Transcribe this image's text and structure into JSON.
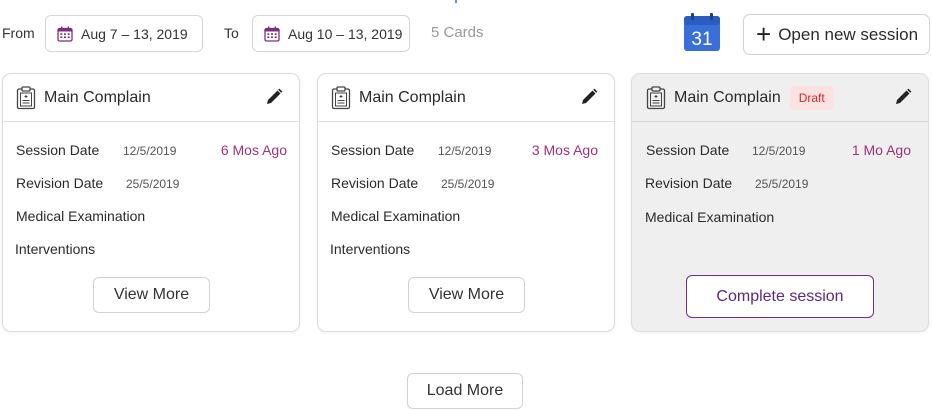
{
  "filters": {
    "from_label": "From",
    "from_value": "Aug 7 – 13, 2019",
    "to_label": "To",
    "to_value": "Aug 10 – 13, 2019",
    "cards_count": "5 Cards"
  },
  "calendar_badge": {
    "day": "31",
    "color": "#3a6fd8"
  },
  "open_session": {
    "label": "Open new session"
  },
  "cards": [
    {
      "title": "Main Complain",
      "session_date_label": "Session Date",
      "session_date": "12/5/2019",
      "ago": "6 Mos Ago",
      "revision_date_label": "Revision Date",
      "revision_date": "25/5/2019",
      "medical_label": "Medical Examination",
      "interventions_label": "Interventions",
      "button_label": "View More"
    },
    {
      "title": "Main Complain",
      "session_date_label": "Session Date",
      "session_date": "12/5/2019",
      "ago": "3 Mos Ago",
      "revision_date_label": "Revision Date",
      "revision_date": "25/5/2019",
      "medical_label": "Medical Examination",
      "interventions_label": "Interventions",
      "button_label": "View More"
    },
    {
      "title": "Main Complain",
      "badge": "Draft",
      "session_date_label": "Session Date",
      "session_date": "12/5/2019",
      "ago": "1 Mo Ago",
      "revision_date_label": "Revision Date",
      "revision_date": "25/5/2019",
      "medical_label": "Medical Examination",
      "button_label": "Complete session"
    }
  ],
  "load_more": {
    "label": "Load More"
  },
  "colors": {
    "accent": "#a0327a",
    "primary_purple": "#6b2f86",
    "draft_bg": "#fde2e2",
    "draft_text": "#d02a2a"
  }
}
